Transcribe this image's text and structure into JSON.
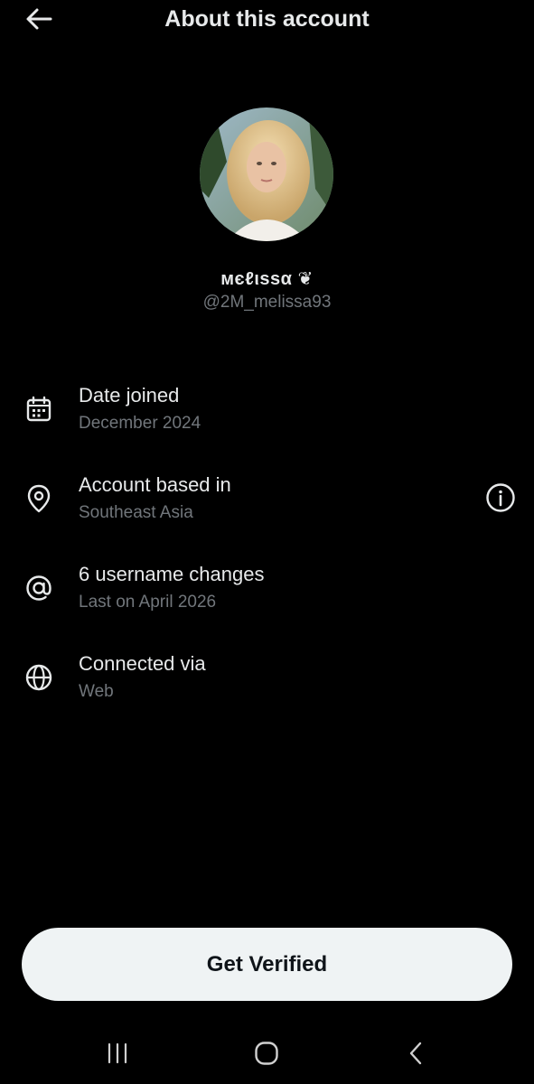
{
  "header": {
    "title": "About this account",
    "back_icon": "arrow-left-icon"
  },
  "profile": {
    "display_name": "мєℓιѕѕα ❦",
    "handle": "@2M_melissa93",
    "avatar": "profile-photo"
  },
  "rows": [
    {
      "icon": "calendar-icon",
      "title": "Date joined",
      "subtitle": "December 2024"
    },
    {
      "icon": "location-pin-icon",
      "title": "Account based in",
      "subtitle": "Southeast Asia",
      "trailing_icon": "info-icon"
    },
    {
      "icon": "at-sign-icon",
      "title": "6 username changes",
      "subtitle": "Last on April 2026"
    },
    {
      "icon": "globe-icon",
      "title": "Connected via",
      "subtitle": "Web"
    }
  ],
  "cta": {
    "label": "Get Verified"
  },
  "system_nav": {
    "recents_icon": "recents-icon",
    "home_icon": "home-icon",
    "back_icon": "system-back-icon"
  },
  "colors": {
    "background": "#000000",
    "primary_text": "#e7e9ea",
    "secondary_text": "#71767b",
    "button_bg": "#eff3f4",
    "button_text": "#0f1419"
  }
}
